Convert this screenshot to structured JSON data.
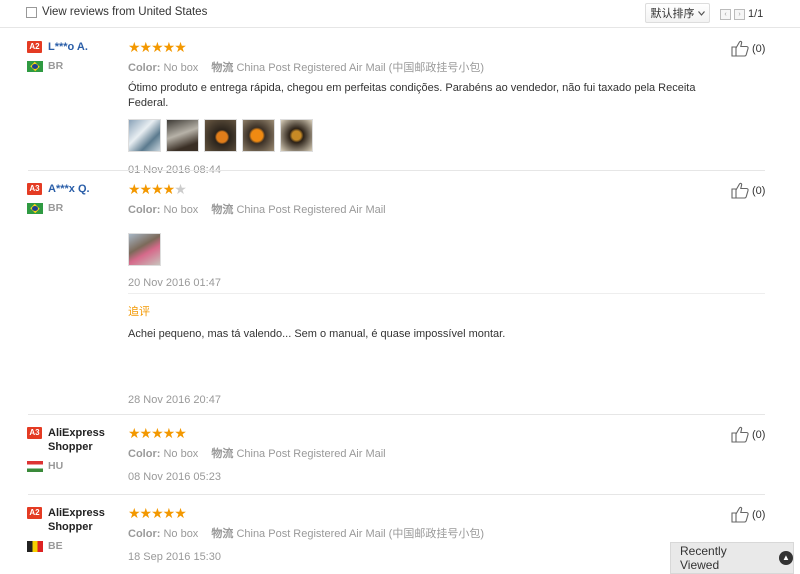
{
  "filter": {
    "label": "View reviews from United States"
  },
  "sort": {
    "label": "默认排序",
    "chevron": "chevron-down-icon"
  },
  "pager": {
    "prev": "‹",
    "next": "›",
    "page": "1/1"
  },
  "labels": {
    "color": "Color:",
    "shipping": "物流"
  },
  "reviews": [
    {
      "badge": "A2",
      "name": "L***o A.",
      "country": "BR",
      "flag": "br",
      "rating": 5,
      "color_value": "No box",
      "shipping_value": "China Post Registered Air Mail (中国邮政挂号小包)",
      "text": "Ótimo produto e entrega rápida, chegou em perfeitas condições. Parabéns ao vendedor, não fui taxado pela Receita Federal.",
      "photos": 5,
      "date": "01 Nov 2016 08:44",
      "likes": "(0)"
    },
    {
      "badge": "A3",
      "name": "A***x Q.",
      "country": "BR",
      "flag": "br",
      "rating": 4,
      "color_value": "No box",
      "shipping_value": "China Post Registered Air Mail",
      "photos": 1,
      "date": "20 Nov 2016 01:47",
      "followup_label": "追评",
      "followup_text": "Achei pequeno, mas tá valendo... Sem o manual, é quase impossível montar.",
      "followup_date": "28 Nov 2016 20:47",
      "likes": "(0)"
    },
    {
      "badge": "A3",
      "name": "AliExpress Shopper",
      "country": "HU",
      "flag": "hu",
      "rating": 5,
      "color_value": "No box",
      "shipping_value": "China Post Registered Air Mail",
      "date": "08 Nov 2016 05:23",
      "likes": "(0)"
    },
    {
      "badge": "A2",
      "name": "AliExpress Shopper",
      "country": "BE",
      "flag": "be",
      "rating": 5,
      "color_value": "No box",
      "shipping_value": "China Post Registered Air Mail (中国邮政挂号小包)",
      "date": "18 Sep 2016 15:30",
      "likes": "(0)"
    }
  ],
  "recently_viewed": {
    "label": "Recently Viewed",
    "icon": "chevron-up-icon"
  },
  "colors": {
    "star": "#f39800",
    "link": "#2a5ea8",
    "badge": "#e43b23",
    "followup": "#f39800"
  }
}
